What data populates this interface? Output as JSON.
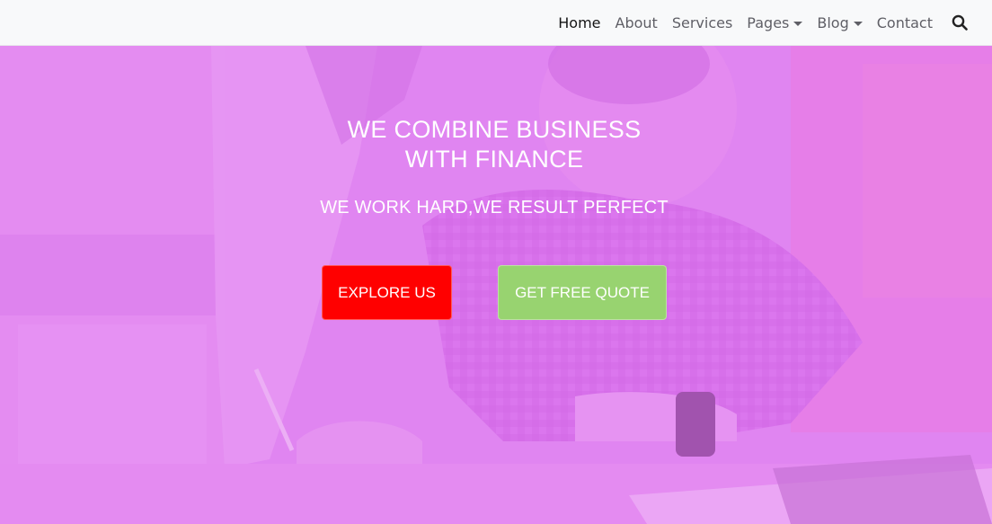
{
  "nav": {
    "items": [
      {
        "label": "Home",
        "active": true,
        "dropdown": false
      },
      {
        "label": "About",
        "active": false,
        "dropdown": false
      },
      {
        "label": "Services",
        "active": false,
        "dropdown": false
      },
      {
        "label": "Pages",
        "active": false,
        "dropdown": true
      },
      {
        "label": "Blog",
        "active": false,
        "dropdown": true
      },
      {
        "label": "Contact",
        "active": false,
        "dropdown": false
      }
    ],
    "search_icon": "search-icon"
  },
  "hero": {
    "title_line1": "WE COMBINE BUSINESS",
    "title_line2": "WITH FINANCE",
    "subtitle": "WE WORK HARD,WE RESULT PERFECT",
    "explore_label": "EXPLORE US",
    "quote_label": "GET FREE QUOTE"
  },
  "colors": {
    "overlay": "#e488f3",
    "explore_button": "#ff0000",
    "quote_button": "#98d370",
    "navbar_bg": "#f8f9fa"
  }
}
